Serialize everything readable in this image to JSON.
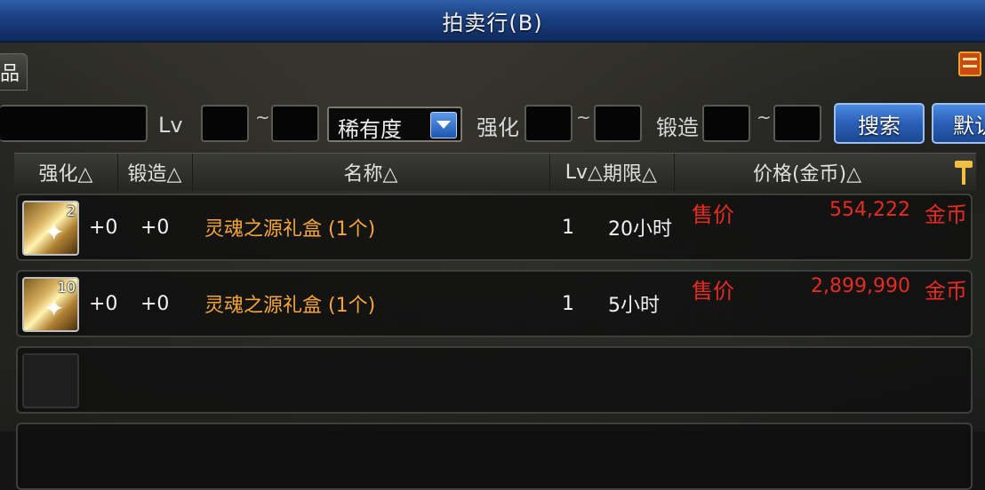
{
  "window": {
    "title": "拍卖行(B)"
  },
  "tab": {
    "label": "品"
  },
  "filter": {
    "lv_label": "Lv",
    "tilde": "~",
    "rarity_select": "稀有度",
    "reinforce_label": "强化",
    "forge_label": "锻造",
    "search_button": "搜索",
    "default_button": "默认"
  },
  "table": {
    "headers": {
      "reinforce": "强化△",
      "forge": "锻造△",
      "name": "名称△",
      "lv": "Lv△",
      "expire": "期限△",
      "price": "价格(金币)△"
    },
    "rows": [
      {
        "count": "2",
        "reinforce": "+0",
        "forge": "+0",
        "name": "灵魂之源礼盒 (1个)",
        "lv": "1",
        "expire": "20小时",
        "sale_label": "售价",
        "price": "554,222",
        "unit": "金币"
      },
      {
        "count": "10",
        "reinforce": "+0",
        "forge": "+0",
        "name": "灵魂之源礼盒 (1个)",
        "lv": "1",
        "expire": "5小时",
        "sale_label": "售价",
        "price": "2,899,990",
        "unit": "金币"
      }
    ]
  },
  "colors": {
    "title_bar": "#1a3f80",
    "item_name": "#f4a638",
    "price": "#e62b22",
    "button": "#2a5fb8"
  }
}
